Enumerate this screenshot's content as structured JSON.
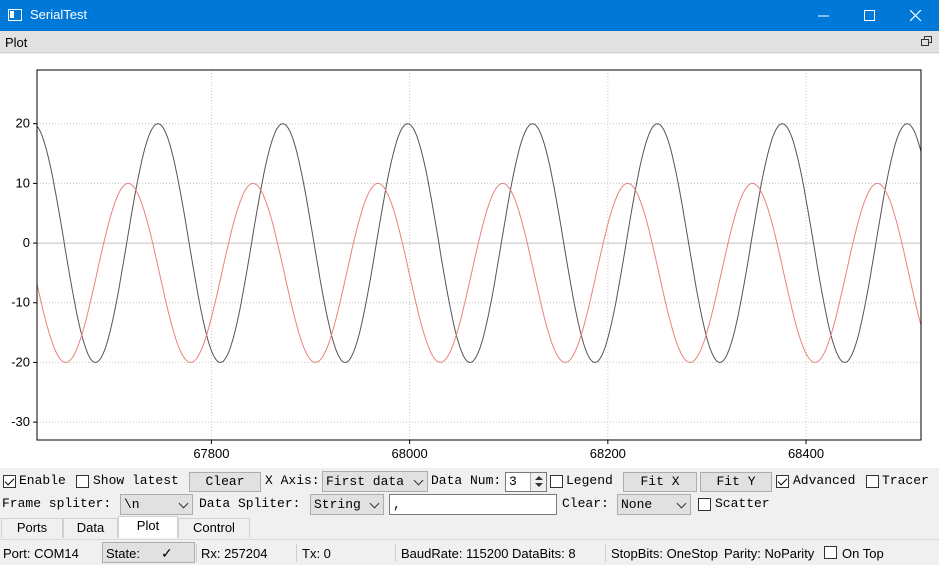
{
  "window": {
    "title": "SerialTest"
  },
  "dock": {
    "title": "Plot"
  },
  "chart_data": {
    "type": "line",
    "xlabel": "",
    "ylabel": "",
    "xlim": [
      67624,
      68516
    ],
    "ylim": [
      -33,
      29
    ],
    "x_ticks": [
      67800,
      68000,
      68200,
      68400
    ],
    "y_ticks": [
      20,
      10,
      0,
      -10,
      -20,
      -30
    ],
    "grid": true,
    "legend": false,
    "series": [
      {
        "color": "#555555",
        "amplitude": 20,
        "period": 126,
        "first_peak_x": 67620,
        "from": 67624,
        "to": 68516
      },
      {
        "color": "#e8837c",
        "amplitude": 15,
        "offset": -5,
        "period": 126,
        "first_peak_x": 67716,
        "from": 67624,
        "to": 68516
      }
    ]
  },
  "controls": {
    "enable_label": "Enable",
    "enable_checked": true,
    "show_latest_label": "Show latest",
    "clear_button": "Clear",
    "x_axis_label": "X Axis:",
    "x_axis_value": "First data",
    "data_num_label": "Data Num:",
    "data_num_value": "3",
    "legend_label": "Legend",
    "fit_x_button": "Fit X",
    "fit_y_button": "Fit Y",
    "advanced_label": "Advanced",
    "advanced_checked": true,
    "tracer_label": "Tracer",
    "frame_splitter_label": "Frame spliter:",
    "frame_splitter_value": "\\n",
    "data_splitter_label": "Data Spliter:",
    "data_splitter_mode": "String",
    "data_splitter_value": ",",
    "clear_label": "Clear:",
    "clear_value": "None",
    "scatter_label": "Scatter"
  },
  "tabs": [
    {
      "label": "Ports"
    },
    {
      "label": "Data"
    },
    {
      "label": "Plot",
      "active": true
    },
    {
      "label": "Control"
    }
  ],
  "status": {
    "port": "Port: COM14",
    "state_label": "State:",
    "state_icon": "✓",
    "rx": "Rx: 257204",
    "tx": "Tx: 0",
    "baud": "BaudRate: 115200",
    "databits": "DataBits: 8",
    "stopbits": "StopBits: OneStop",
    "parity": "Parity: NoParity",
    "on_top": "On Top"
  }
}
